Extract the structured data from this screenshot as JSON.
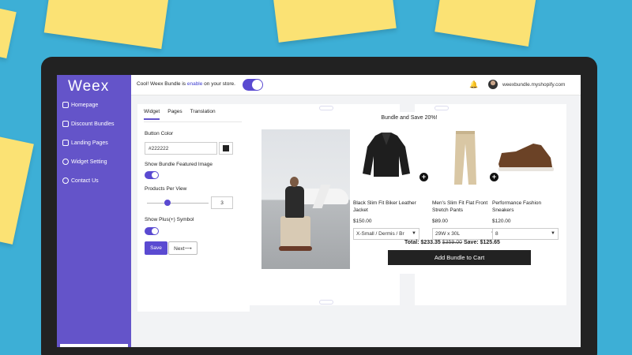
{
  "sidebar": {
    "logo": "Weex",
    "items": [
      {
        "label": "Homepage",
        "icon": "home-icon"
      },
      {
        "label": "Discount Bundles",
        "icon": "tag-icon"
      },
      {
        "label": "Landing Pages",
        "icon": "page-icon"
      },
      {
        "label": "Widget Setting",
        "icon": "gear-icon"
      },
      {
        "label": "Contact Us",
        "icon": "chat-icon"
      }
    ]
  },
  "topbar": {
    "msg_prefix": "Cool! Weex Bundle is ",
    "msg_link": "enable",
    "msg_suffix": " on your store.",
    "bell": "🔔",
    "store": "weexbundle.myshopify.com"
  },
  "panel": {
    "tabs": [
      "Widget",
      "Pages",
      "Translation"
    ],
    "button_color_label": "Button Color",
    "button_color_value": "#222222",
    "featured_image_label": "Show Bundle Featured Image",
    "products_per_view_label": "Products Per View",
    "products_per_view_value": "3",
    "plus_symbol_label": "Show Plus(+) Symbol",
    "save_label": "Save",
    "next_label": "Next⟶"
  },
  "widget": {
    "title": "Bundle and Save 20%!",
    "products": [
      {
        "name": "Black Slim Fit Biker Leather Jacket",
        "price": "$150.00",
        "variant": "X-Small / Dermis / Br"
      },
      {
        "name": "Men's Slim Fit Flat Front Stretch Pants",
        "price": "$89.00",
        "variant": "29W x 30L"
      },
      {
        "name": "Performance Fashion Sneakers",
        "price": "$120.00",
        "variant": "8"
      }
    ],
    "plus": "+",
    "total_label": "Total: $233.35 ",
    "total_original": "$359.00",
    "save_text": "  Save: $125.65",
    "add_to_cart": "Add Bundle to Cart",
    "chevron": "▼"
  },
  "colors": {
    "sidebar": "#6454c9",
    "accent": "#5a4ad1",
    "button": "#222222"
  }
}
